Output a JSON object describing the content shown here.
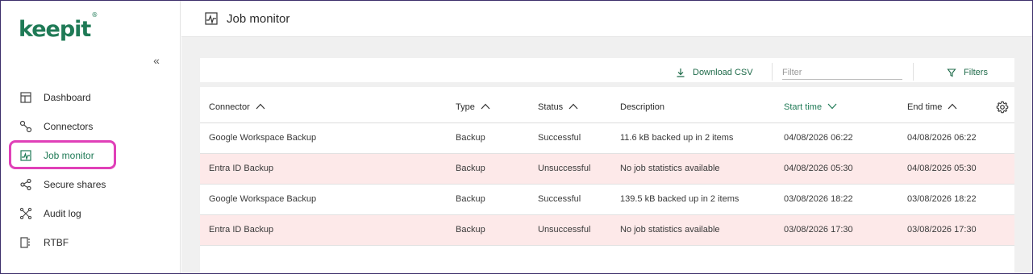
{
  "brand": {
    "logo_text": "keepit",
    "logo_mark": "®",
    "color": "#1f7a56"
  },
  "sidebar": {
    "collapse_label": "«",
    "items": [
      {
        "label": "Dashboard",
        "icon": "dashboard-icon"
      },
      {
        "label": "Connectors",
        "icon": "connectors-icon"
      },
      {
        "label": "Job monitor",
        "icon": "job-monitor-icon",
        "active": true
      },
      {
        "label": "Secure shares",
        "icon": "share-icon"
      },
      {
        "label": "Audit log",
        "icon": "audit-log-icon"
      },
      {
        "label": "RTBF",
        "icon": "rtbf-icon"
      }
    ]
  },
  "header": {
    "title": "Job monitor"
  },
  "toolbar": {
    "download_label": "Download CSV",
    "filter_placeholder": "Filter",
    "filters_label": "Filters"
  },
  "table": {
    "columns": [
      {
        "label": "Connector",
        "sort": "asc"
      },
      {
        "label": "Type",
        "sort": "asc"
      },
      {
        "label": "Status",
        "sort": "asc"
      },
      {
        "label": "Description",
        "sort": ""
      },
      {
        "label": "Start time",
        "sort": "desc",
        "active": true
      },
      {
        "label": "End time",
        "sort": "asc"
      }
    ],
    "rows": [
      {
        "connector": "Google Workspace Backup",
        "type": "Backup",
        "status": "Successful",
        "description": "11.6 kB backed up in 2 items",
        "start": "04/08/2026 06:22",
        "end": "04/08/2026 06:22",
        "error": false
      },
      {
        "connector": "Entra ID Backup",
        "type": "Backup",
        "status": "Unsuccessful",
        "description": "No job statistics available",
        "start": "04/08/2026 05:30",
        "end": "04/08/2026 05:30",
        "error": true
      },
      {
        "connector": "Google Workspace Backup",
        "type": "Backup",
        "status": "Successful",
        "description": "139.5 kB backed up in 2 items",
        "start": "03/08/2026 18:22",
        "end": "03/08/2026 18:22",
        "error": false
      },
      {
        "connector": "Entra ID Backup",
        "type": "Backup",
        "status": "Unsuccessful",
        "description": "No job statistics available",
        "start": "03/08/2026 17:30",
        "end": "03/08/2026 17:30",
        "error": true
      }
    ]
  },
  "colors": {
    "accent": "#1f7a56",
    "error_row": "#fde9e9",
    "highlight": "#e040b8"
  }
}
